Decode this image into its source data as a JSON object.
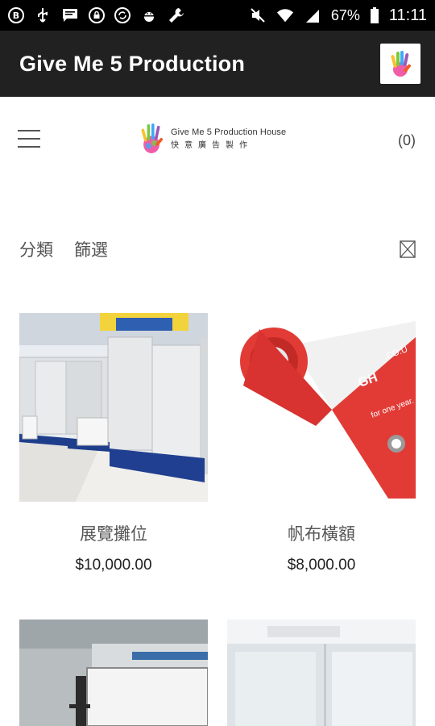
{
  "status_bar": {
    "battery_percent": "67%",
    "time": "11:11",
    "icons": [
      "b-badge-icon",
      "usb-icon",
      "message-icon",
      "lock-icon",
      "sync-icon",
      "android-debug-icon",
      "wrench-icon",
      "mute-icon",
      "wifi-icon",
      "signal-icon",
      "battery-icon"
    ]
  },
  "app_bar": {
    "title": "Give Me 5 Production"
  },
  "site_header": {
    "brand_name": "Give Me 5 Production House",
    "brand_subtitle": "快意廣告製作",
    "cart_count": "(0)"
  },
  "filters": {
    "category_label": "分類",
    "filter_label": "篩選"
  },
  "products": [
    {
      "name": "展覽攤位",
      "price": "$10,000.00"
    },
    {
      "name": "帆布橫額",
      "price": "$8,000.00"
    },
    {
      "name": "",
      "price": ""
    },
    {
      "name": "",
      "price": ""
    }
  ],
  "colors": {
    "appbar": "#212121",
    "statusbar": "#000000",
    "banner_red": "#e23b36"
  }
}
